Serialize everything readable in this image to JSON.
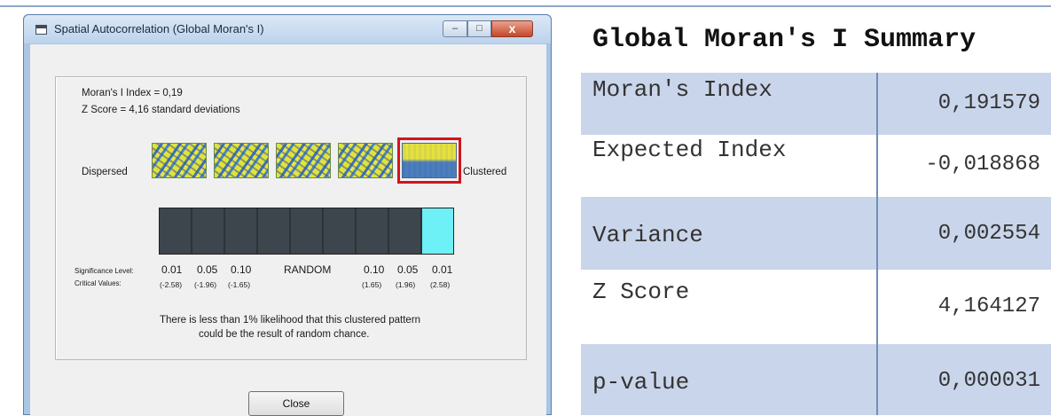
{
  "window": {
    "title": "Spatial Autocorrelation (Global Moran's I)",
    "controls": {
      "minimize": "–",
      "maximize": "□",
      "close": "x"
    }
  },
  "report": {
    "morans_index_line": "Moran's I Index = 0,19",
    "z_score_line": "Z Score = 4,16 standard deviations",
    "dispersed_label": "Dispersed",
    "clustered_label": "Clustered",
    "highlighted_pattern": "clustered",
    "significance_label": "Significance Level:",
    "critical_label": "Critical Values:",
    "significance_levels": [
      "0.01",
      "0.05",
      "0.10",
      "RANDOM",
      "0.10",
      "0.05",
      "0.01"
    ],
    "critical_values": [
      "(-2.58)",
      "(-1.96)",
      "(-1.65)",
      "(1.65)",
      "(1.96)",
      "(2.58)"
    ],
    "interpretation_line1": "There is less than 1% likelihood that this clustered pattern",
    "interpretation_line2": "could be the result of random chance.",
    "close_button": "Close",
    "active_segment_color": "#6df0f6",
    "highlight_color": "#d4141a"
  },
  "summary": {
    "title": "Global Moran's I Summary",
    "rows": [
      {
        "label": "Moran's Index",
        "value": "0,191579"
      },
      {
        "label": "Expected Index",
        "value": "-0,018868"
      },
      {
        "label": "Variance",
        "value": "0,002554"
      },
      {
        "label": "Z Score",
        "value": "4,164127"
      },
      {
        "label": "p-value",
        "value": "0,000031"
      }
    ],
    "row_colors": [
      "#c9d5ea",
      "#ffffff"
    ],
    "divider_color": "#6f8fbb"
  }
}
